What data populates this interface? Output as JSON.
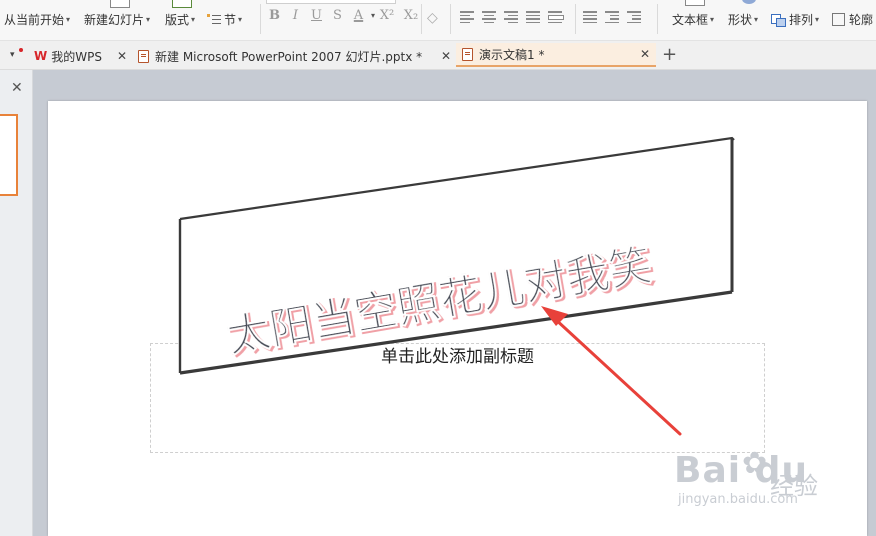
{
  "ribbon": {
    "play_from_current": "从当前开始",
    "new_slide": "新建幻灯片",
    "layout": "版式",
    "section": "节",
    "format_buttons": [
      "B",
      "I",
      "U",
      "S",
      "A",
      "X²",
      "X₂"
    ],
    "text_box": "文本框",
    "shape": "形状",
    "arrange": "排列",
    "outline": "轮廓"
  },
  "tabs": [
    {
      "label": "我的WPS"
    },
    {
      "label": "新建 Microsoft PowerPoint 2007 幻灯片.pptx *"
    },
    {
      "label": "演示文稿1 *"
    }
  ],
  "slide": {
    "title_text": "太阳当空照花儿对我笑",
    "subtitle_placeholder": "单击此处添加副标题"
  },
  "watermark": {
    "logo": "Bai du",
    "cn": "经验",
    "url": "jingyan.baidu.com"
  },
  "colors": {
    "accent_orange": "#e8a468",
    "wps_red": "#d7262a",
    "arrow_red": "#e8413a",
    "wordart_shadow": "#f0a0a6"
  }
}
